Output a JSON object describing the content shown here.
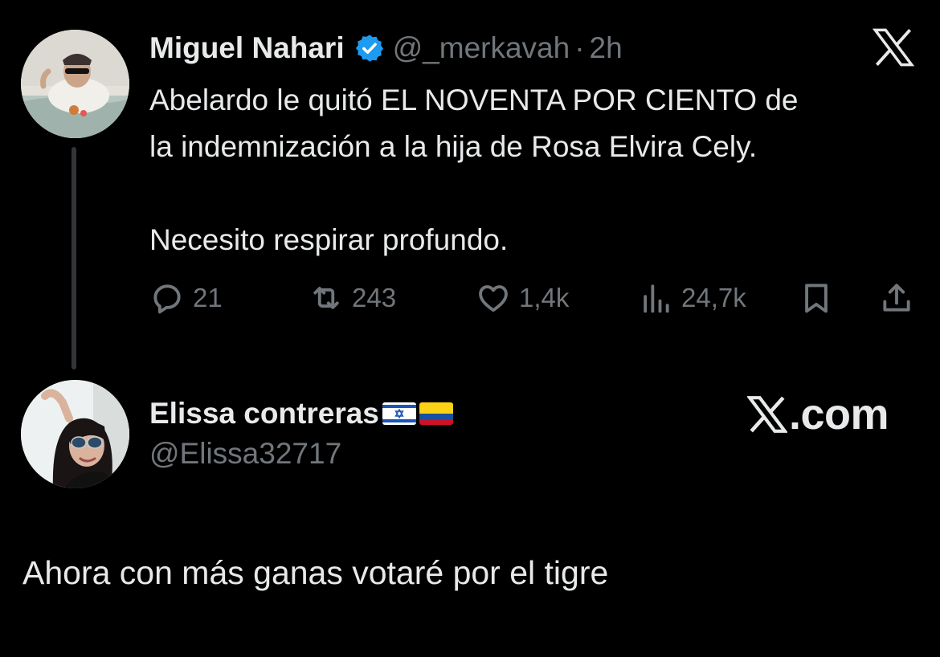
{
  "tweet": {
    "author_name": "Miguel Nahari",
    "author_handle": "@_merkavah",
    "separator": "·",
    "time": "2h",
    "lines": [
      "Abelardo le quitó EL NOVENTA POR CIENTO de",
      "la indemnización a la hija de Rosa Elvira Cely.",
      "Necesito respirar profundo."
    ],
    "actions": {
      "replies": "21",
      "reposts": "243",
      "likes": "1,4k",
      "views": "24,7k"
    },
    "icons": [
      "verified-badge-icon",
      "x-logo-icon",
      "reply-icon",
      "repost-icon",
      "like-icon",
      "views-icon",
      "bookmark-icon",
      "share-icon"
    ]
  },
  "reply": {
    "author_name": "Elissa contreras",
    "author_handle": "@Elissa32717",
    "flags": [
      "israel-flag-icon",
      "colombia-flag-icon"
    ],
    "watermark": ".com",
    "text": "Ahora con más ganas votaré por el tigre"
  },
  "colors": {
    "background": "#000000",
    "text": "#e7e9ea",
    "muted": "#71767b",
    "verified": "#1d9bf0",
    "thread_line": "#333639"
  }
}
